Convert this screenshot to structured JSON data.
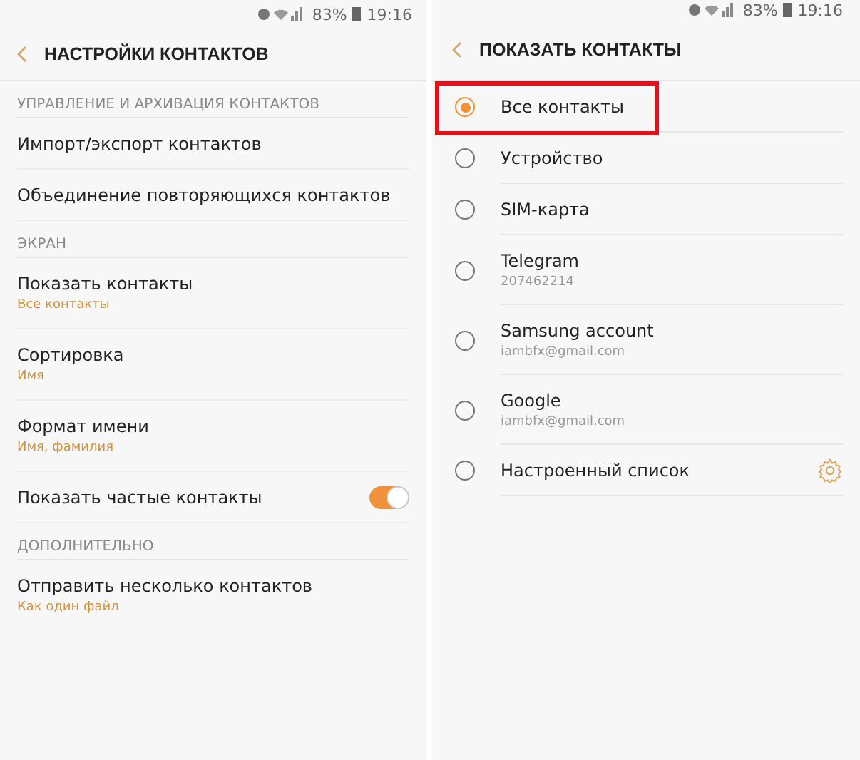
{
  "left_screen": {
    "status_bar": {
      "battery": "83%",
      "time": "19:16"
    },
    "title": "НАСТРОЙКИ КОНТАКТОВ",
    "items": [
      {
        "kind": "section",
        "label": "УПРАВЛЕНИЕ И АРХИВАЦИЯ КОНТАКТОВ"
      },
      {
        "kind": "item",
        "label": "Импорт/экспорт контактов"
      },
      {
        "kind": "item",
        "label": "Объединение повторяющихся контактов"
      },
      {
        "kind": "section",
        "label": "ЭКРАН"
      },
      {
        "kind": "item",
        "label": "Показать контакты",
        "value": "Все контакты"
      },
      {
        "kind": "item",
        "label": "Сортировка",
        "value": "Имя"
      },
      {
        "kind": "item",
        "label": "Формат имени",
        "value": "Имя, фамилия"
      },
      {
        "kind": "toggle",
        "label": "Показать частые контакты",
        "on": true
      },
      {
        "kind": "section",
        "label": "ДОПОЛНИТЕЛЬНО"
      },
      {
        "kind": "item",
        "label": "Отправить несколько контактов",
        "value": "Как один файл"
      }
    ]
  },
  "right_screen": {
    "status_bar": {
      "battery": "83%",
      "time": "19:16"
    },
    "title": "ПОКАЗАТЬ КОНТАКТЫ",
    "options": [
      {
        "label": "Все контакты",
        "selected": true,
        "highlighted": true
      },
      {
        "label": "Устройство",
        "selected": false,
        "highlighted": false
      },
      {
        "label": "SIM-карта",
        "selected": false,
        "highlighted": false
      },
      {
        "label": "Telegram",
        "detail": "207462214",
        "selected": false,
        "highlighted": false
      },
      {
        "label": "Samsung account",
        "detail": "iambfx@gmail.com",
        "selected": false,
        "highlighted": false
      },
      {
        "label": "Google",
        "detail": "iambfx@gmail.com",
        "selected": false,
        "highlighted": false
      },
      {
        "label": "Настроенный список",
        "selected": false,
        "highlighted": false,
        "settings": true
      }
    ]
  }
}
